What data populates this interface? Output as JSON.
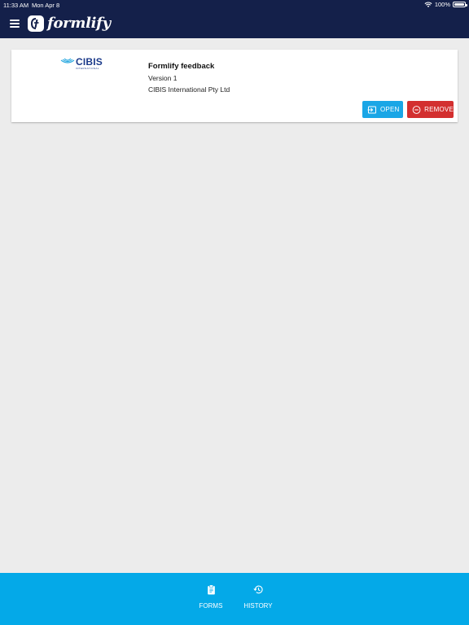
{
  "status_bar": {
    "time": "11:33 AM",
    "date": "Mon Apr 8",
    "battery": "100%"
  },
  "header": {
    "app_name": "formlify",
    "menu_icon": "hamburger-menu-icon"
  },
  "forms": [
    {
      "logo_text": "CIBIS",
      "logo_subtext": "INTERNATIONAL",
      "title": "Formlify feedback",
      "version": "Version 1",
      "organization": "CIBIS International Pty Ltd",
      "open_label": "OPEN",
      "remove_label": "REMOVE"
    }
  ],
  "bottom_nav": {
    "items": [
      {
        "label": "FORMS",
        "icon": "clipboard-icon"
      },
      {
        "label": "HISTORY",
        "icon": "history-icon"
      }
    ]
  },
  "colors": {
    "header_bg": "#14204a",
    "bottom_nav_bg": "#04a9e8",
    "open_button": "#1aa6e6",
    "remove_button": "#d32f2f",
    "background": "#ececec"
  }
}
